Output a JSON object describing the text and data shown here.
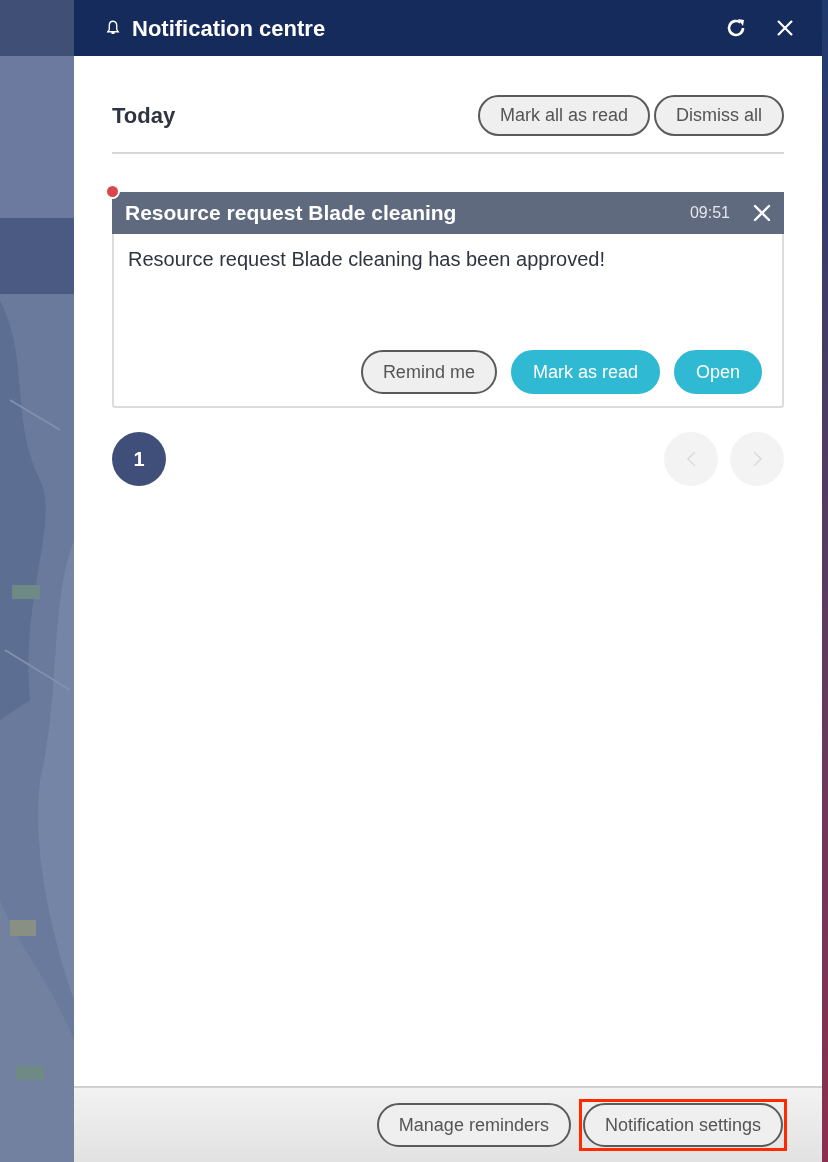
{
  "window": {
    "title": "Notification centre"
  },
  "section": {
    "title": "Today",
    "actions": [
      "Mark all as read",
      "Dismiss all"
    ]
  },
  "notifications": [
    {
      "title": "Resource request Blade cleaning",
      "time": "09:51",
      "unread": true,
      "message": "Resource request Blade cleaning has been approved!",
      "actions": [
        {
          "label": "Remind me",
          "kind": "secondary"
        },
        {
          "label": "Mark as read",
          "kind": "primary"
        },
        {
          "label": "Open",
          "kind": "primary"
        }
      ]
    }
  ],
  "pagination": {
    "pages": [
      {
        "label": "1",
        "selected": true
      }
    ],
    "prev_disabled": true,
    "next_disabled": true
  },
  "footer": {
    "buttons": [
      {
        "label": "Manage reminders",
        "highlighted": false
      },
      {
        "label": "Notification settings",
        "highlighted": true
      }
    ]
  }
}
